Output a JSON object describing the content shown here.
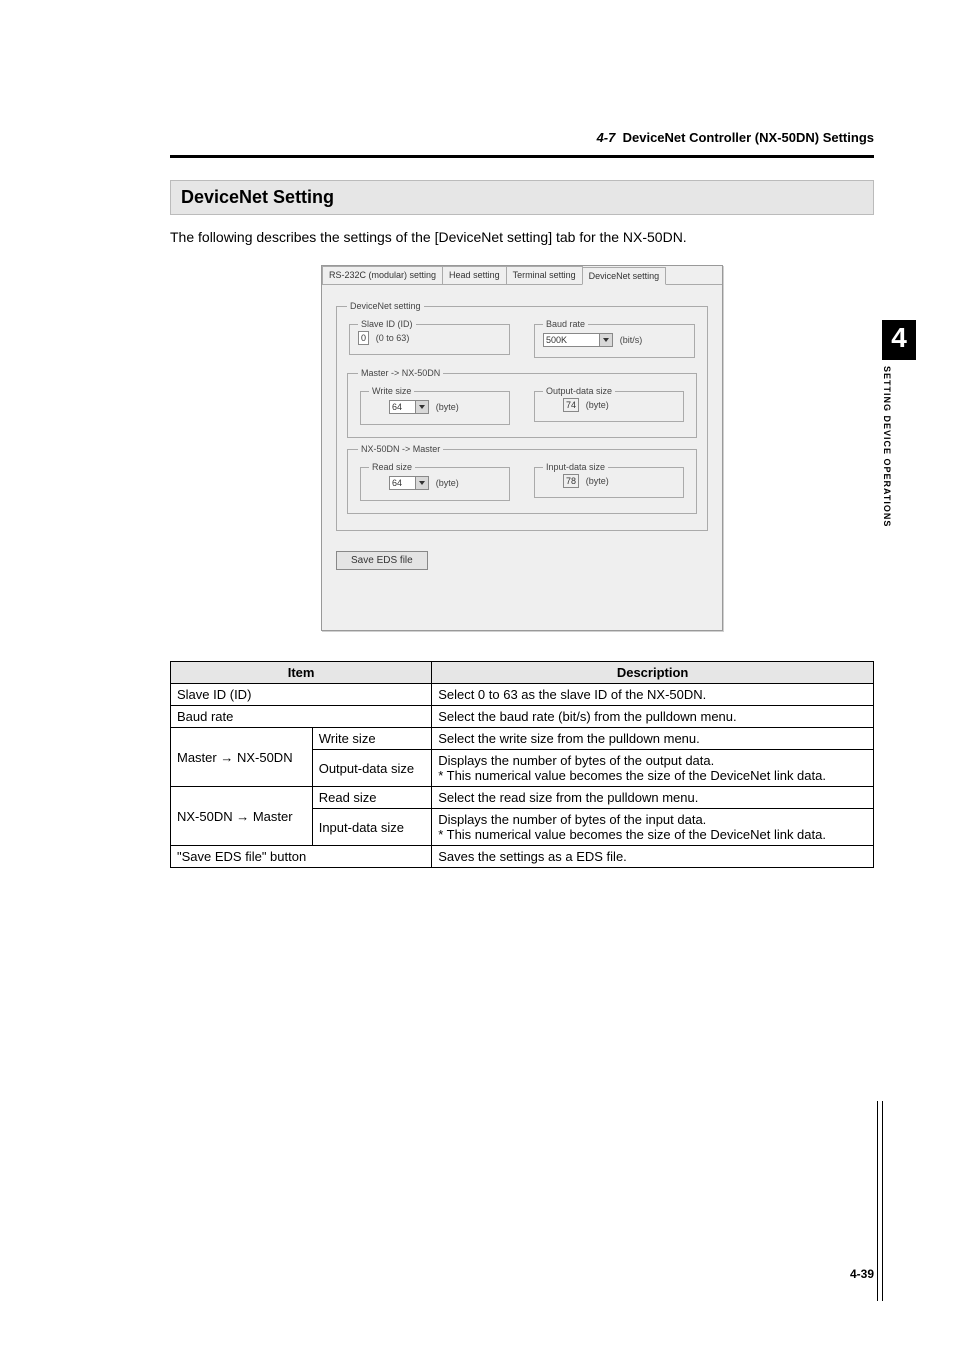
{
  "header": {
    "num": "4-7",
    "title": "DeviceNet Controller (NX-50DN) Settings"
  },
  "section_title": "DeviceNet Setting",
  "intro": "The following describes the settings of the [DeviceNet setting] tab for the NX-50DN.",
  "screenshot": {
    "tabs": {
      "t1": "RS-232C (modular) setting",
      "t2": "Head setting",
      "t3": "Terminal setting",
      "t4": "DeviceNet setting"
    },
    "group1_legend": "DeviceNet setting",
    "slave_id_legend": "Slave ID (ID)",
    "slave_id_value": "0",
    "slave_id_range": "(0 to 63)",
    "baud_legend": "Baud rate",
    "baud_value": "500K",
    "baud_unit": "(bit/s)",
    "group2_legend": "Master -> NX-50DN",
    "write_size_legend": "Write size",
    "write_size_value": "64",
    "write_size_unit": "(byte)",
    "output_legend": "Output-data size",
    "output_value": "74",
    "output_unit": "(byte)",
    "group3_legend": "NX-50DN -> Master",
    "read_size_legend": "Read size",
    "read_size_value": "64",
    "read_size_unit": "(byte)",
    "input_legend": "Input-data size",
    "input_value": "78",
    "input_unit": "(byte)",
    "save_btn": "Save EDS file"
  },
  "table_header": {
    "item": "Item",
    "desc": "Description"
  },
  "table": {
    "r1_item": "Slave ID (ID)",
    "r1_desc": "Select 0 to 63 as the slave ID of the NX-50DN.",
    "r2_item": "Baud rate",
    "r2_desc": "Select the baud rate (bit/s) from the pulldown menu.",
    "r3_group": "Master → NX-50DN",
    "r3a_item": "Write size",
    "r3a_desc": "Select the write size from the pulldown menu.",
    "r3b_item": "Output-data size",
    "r3b_desc1": "Displays the number of bytes of the output data.",
    "r3b_desc2": "* This numerical value becomes the size of the DeviceNet link data.",
    "r4_group": "NX-50DN → Master",
    "r4a_item": "Read size",
    "r4a_desc": "Select the read size from the pulldown menu.",
    "r4b_item": "Input-data size",
    "r4b_desc1": "Displays the number of bytes of the input data.",
    "r4b_desc2": "* This numerical value becomes the size of the DeviceNet link data.",
    "r5_item": "\"Save EDS file\" button",
    "r5_desc": "Saves the settings as a EDS file."
  },
  "side": {
    "num": "4",
    "text": "SETTING DEVICE OPERATIONS"
  },
  "footer": "4-39"
}
